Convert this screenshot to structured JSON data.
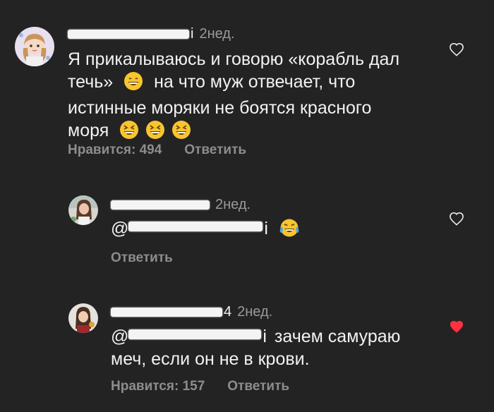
{
  "comments": [
    {
      "username_tail": "i",
      "time": "2нед.",
      "text_line1": "Я прикалываюсь и говорю «корабль дал",
      "text_line2_a": "течь»",
      "text_line2_b": "на что муж отвечает, что",
      "text_line3": "истинные моряки не боятся красного",
      "text_line4": "моря",
      "likes_label": "Нравится: 494",
      "reply_label": "Ответить",
      "liked": false
    },
    {
      "time": "2нед.",
      "mention_prefix": "@",
      "mention_tail": "i",
      "reply_label": "Ответить",
      "liked": false
    },
    {
      "username_tail": "4",
      "time": "2нед.",
      "mention_prefix": "@",
      "mention_tail": "i",
      "text_line1": "зачем самураю",
      "text_line2": "меч, если он не в крови.",
      "likes_label": "Нравится: 157",
      "reply_label": "Ответить",
      "liked": true
    }
  ],
  "colors": {
    "background": "#232324",
    "text": "#f2f2f2",
    "muted": "#8d8d8f",
    "like_red": "#ff3040"
  },
  "icons": [
    "heart-outline-icon",
    "heart-filled-icon",
    "grin-emoji-icon",
    "laughing-emoji-icon",
    "tears-of-joy-emoji-icon"
  ]
}
